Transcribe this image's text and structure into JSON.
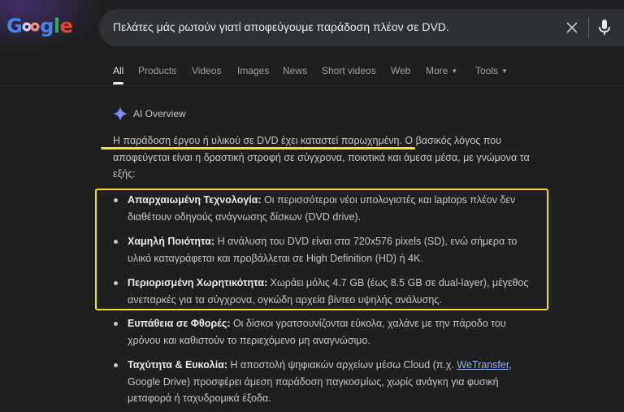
{
  "logo": {
    "text_left": "G",
    "text_right": "gle",
    "colors": [
      "#4285f4",
      "#ea4335",
      "#fbbc05",
      "#34a853"
    ]
  },
  "search": {
    "query": "Πελάτες μάς ρωτούν γιατί αποφεύγουμε παράδοση πλέον σε DVD.",
    "clear_icon": "close-icon",
    "mic_icon": "microphone-icon"
  },
  "tabs": {
    "all": "All",
    "products": "Products",
    "videos": "Videos",
    "images": "Images",
    "news": "News",
    "short_videos": "Short videos",
    "web": "Web",
    "more": "More",
    "tools": "Tools"
  },
  "ai_overview": {
    "label": "AI Overview",
    "intro": "Η παράδοση έργου ή υλικού σε DVD έχει καταστεί παρωχημένη. Ο βασικός λόγος που αποφεύγεται είναι η δραστική στροφή σε σύγχρονα, ποιοτικά και άμεσα μέσα, με γνώμονα τα εξής:",
    "bullets": [
      {
        "title": "Απαρχαιωμένη Τεχνολογία:",
        "text": " Οι περισσότεροι νέοι υπολογιστές και laptops πλέον δεν διαθέτουν οδηγούς ανάγνωσης δίσκων (DVD drive)."
      },
      {
        "title": "Χαμηλή Ποιότητα:",
        "text": " Η ανάλυση του DVD είναι στα 720x576 pixels (SD), ενώ σήμερα το υλικό καταγράφεται και προβάλλεται σε High Definition (HD) ή 4K."
      },
      {
        "title": "Περιορισμένη Χωρητικότητα:",
        "text": " Χωράει μόλις 4.7 GB (έως 8.5 GB σε dual-layer), μέγεθος ανεπαρκές για τα σύγχρονα, ογκώδη αρχεία βίντεο υψηλής ανάλυσης."
      },
      {
        "title": "Ευπάθεια σε Φθορές:",
        "text": " Οι δίσκοι γρατσουνίζονται εύκολα, χαλάνε με την πάροδο του χρόνου και καθιστούν το περιεχόμενο μη αναγνώσιμο."
      },
      {
        "title": "Ταχύτητα & Ευκολία:",
        "text_before": " Η αποστολή ψηφιακών αρχείων μέσω Cloud (π.χ. ",
        "link": "WeTransfer",
        "text_after": ", Google Drive) προσφέρει άμεση παράδοση παγκοσμίως, χωρίς ανάγκη για φυσική μεταφορά ή ταχυδρομικά έξοδα."
      }
    ]
  },
  "annotation_color": "#ece01f"
}
